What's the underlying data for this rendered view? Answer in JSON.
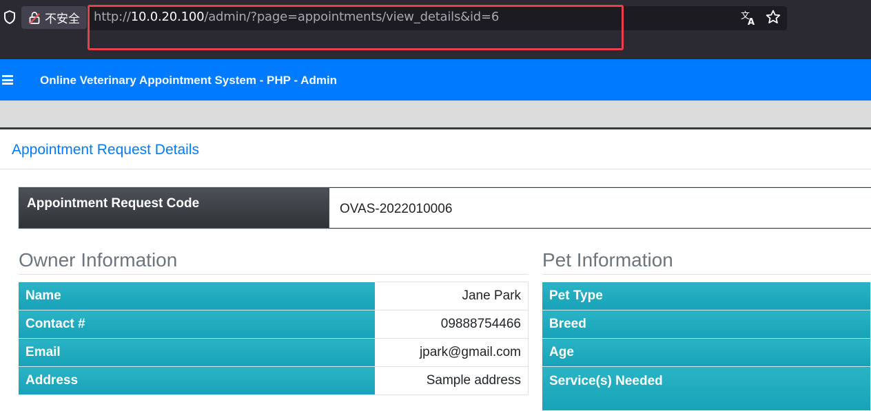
{
  "browser": {
    "security_label": "不安全",
    "url": {
      "scheme": "http://",
      "host": "10.0.20.100",
      "path": "/admin/?page=appointments/view_details&id=6"
    },
    "icons": [
      "shield-icon",
      "lock-icon",
      "translate-icon",
      "bookmark-star-icon"
    ]
  },
  "navbar": {
    "title": "Online Veterinary Appointment System - PHP - Admin",
    "menu_icon": "hamburger-icon"
  },
  "card": {
    "title": "Appointment Request Details",
    "code_label": "Appointment Request Code",
    "code_value": "OVAS-2022010006"
  },
  "owner": {
    "heading": "Owner Information",
    "rows": [
      {
        "label": "Name",
        "value": "Jane Park"
      },
      {
        "label": "Contact #",
        "value": "09888754466"
      },
      {
        "label": "Email",
        "value": "jpark@gmail.com"
      },
      {
        "label": "Address",
        "value": "Sample address"
      }
    ]
  },
  "pet": {
    "heading": "Pet Information",
    "rows": [
      {
        "label": "Pet Type"
      },
      {
        "label": "Breed"
      },
      {
        "label": "Age"
      },
      {
        "label": "Service(s) Needed"
      }
    ]
  },
  "colors": {
    "navbar": "#007bff",
    "highlight": "#e8404a",
    "info_label_bg": "#17a2b8",
    "code_label_bg": "#343a40"
  }
}
